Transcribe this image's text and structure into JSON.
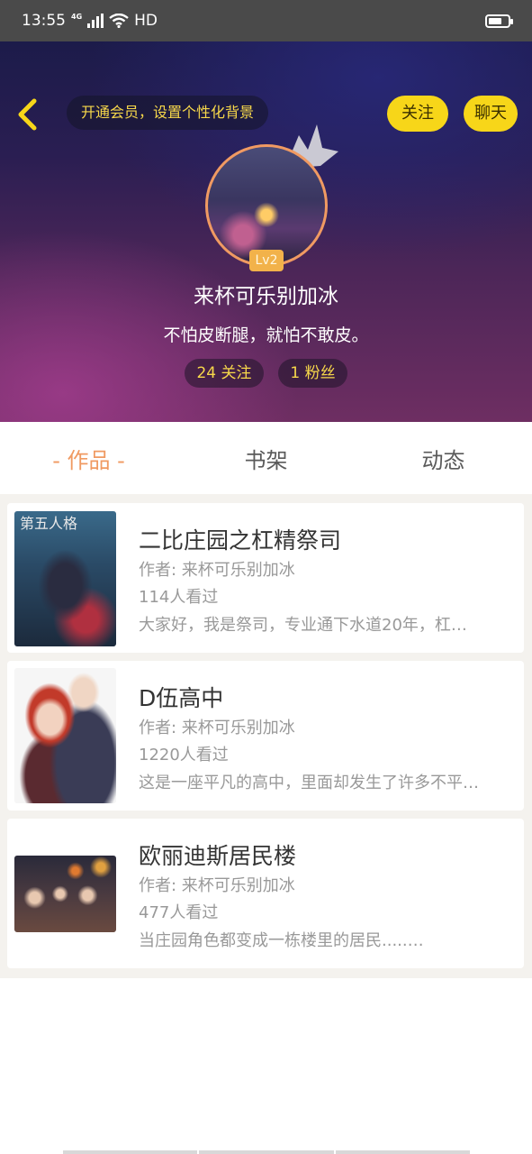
{
  "status_bar": {
    "time": "13:55",
    "network": "4G",
    "hd": "HD",
    "icons": [
      "signal-icon",
      "wifi-icon",
      "battery-icon"
    ]
  },
  "header": {
    "back_icon": "chevron-left-icon",
    "vip_text": "开通会员，设置个性化背景",
    "follow_label": "关注",
    "chat_label": "聊天"
  },
  "profile": {
    "level": "Lv2",
    "nickname": "来杯可乐别加冰",
    "signature": "不怕皮断腿，就怕不敢皮。",
    "following": "24 关注",
    "fans": "1 粉丝"
  },
  "tabs": [
    {
      "label": "- 作品 -",
      "active": true
    },
    {
      "label": "书架",
      "active": false
    },
    {
      "label": "动态",
      "active": false
    }
  ],
  "works": [
    {
      "cover_text": "第五人格",
      "title": "二比庄园之杠精祭司",
      "author": "作者: 来杯可乐别加冰",
      "views": "114人看过",
      "desc": "大家好，我是祭司，专业通下水道20年，杠…"
    },
    {
      "title": "D伍高中",
      "author": "作者: 来杯可乐别加冰",
      "views": "1220人看过",
      "desc": "这是一座平凡的高中，里面却发生了许多不平…"
    },
    {
      "title": "欧丽迪斯居民楼",
      "author": "作者: 来杯可乐别加冰",
      "views": "477人看过",
      "desc": "当庄园角色都变成一栋楼里的居民.....…"
    }
  ],
  "colors": {
    "accent": "#f09a62",
    "button_yellow": "#f7d619",
    "vip_text": "#f7d84a"
  }
}
